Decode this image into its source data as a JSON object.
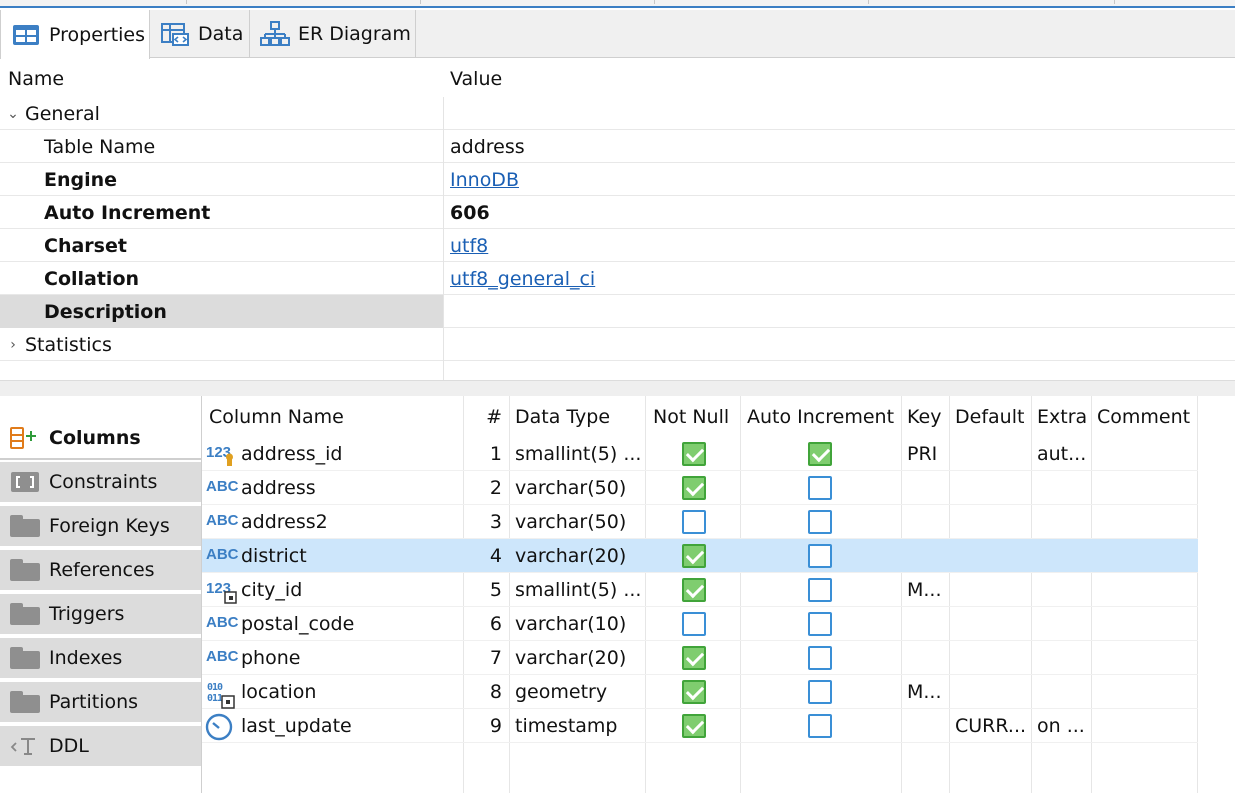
{
  "tabs": [
    {
      "label": "Properties",
      "icon": "properties-icon",
      "active": true
    },
    {
      "label": "Data",
      "icon": "data-grid-icon",
      "active": false
    },
    {
      "label": "ER Diagram",
      "icon": "er-diagram-icon",
      "active": false
    }
  ],
  "properties": {
    "header": {
      "name": "Name",
      "value": "Value"
    },
    "group_general": "General",
    "rows": [
      {
        "name": "Table Name",
        "value": "address"
      },
      {
        "name": "Engine",
        "value": "InnoDB"
      },
      {
        "name": "Auto Increment",
        "value": "606"
      },
      {
        "name": "Charset",
        "value": "utf8"
      },
      {
        "name": "Collation",
        "value": "utf8_general_ci"
      },
      {
        "name": "Description",
        "value": ""
      }
    ],
    "group_statistics": "Statistics"
  },
  "side_tabs": [
    {
      "label": "Columns",
      "icon": "columns-add-icon"
    },
    {
      "label": "Constraints",
      "icon": "constraints-icon"
    },
    {
      "label": "Foreign Keys",
      "icon": "folder-icon"
    },
    {
      "label": "References",
      "icon": "folder-icon"
    },
    {
      "label": "Triggers",
      "icon": "folder-icon"
    },
    {
      "label": "Indexes",
      "icon": "folder-icon"
    },
    {
      "label": "Partitions",
      "icon": "folder-icon"
    },
    {
      "label": "DDL",
      "icon": "ddl-icon"
    }
  ],
  "columns_table": {
    "headers": {
      "name": "Column Name",
      "num": "#",
      "type": "Data Type",
      "notnull": "Not Null",
      "autoinc": "Auto Increment",
      "key": "Key",
      "default": "Default",
      "extra": "Extra",
      "comment": "Comment"
    },
    "rows": [
      {
        "name": "address_id",
        "num": "1",
        "type": "smallint(5) ...",
        "notnull": true,
        "autoinc": true,
        "key": "PRI",
        "default": "",
        "extra": "aut...",
        "comment": "",
        "icon": "numeric-key-icon",
        "icon_text": "123"
      },
      {
        "name": "address",
        "num": "2",
        "type": "varchar(50)",
        "notnull": true,
        "autoinc": false,
        "key": "",
        "default": "",
        "extra": "",
        "comment": "",
        "icon": "text-column-icon",
        "icon_text": "ABC"
      },
      {
        "name": "address2",
        "num": "3",
        "type": "varchar(50)",
        "notnull": false,
        "autoinc": false,
        "key": "",
        "default": "",
        "extra": "",
        "comment": "",
        "icon": "text-column-icon",
        "icon_text": "ABC"
      },
      {
        "name": "district",
        "num": "4",
        "type": "varchar(20)",
        "notnull": true,
        "autoinc": false,
        "key": "",
        "default": "",
        "extra": "",
        "comment": "",
        "icon": "text-column-icon",
        "icon_text": "ABC"
      },
      {
        "name": "city_id",
        "num": "5",
        "type": "smallint(5) ...",
        "notnull": true,
        "autoinc": false,
        "key": "M...",
        "default": "",
        "extra": "",
        "comment": "",
        "icon": "numeric-index-icon",
        "icon_text": "123"
      },
      {
        "name": "postal_code",
        "num": "6",
        "type": "varchar(10)",
        "notnull": false,
        "autoinc": false,
        "key": "",
        "default": "",
        "extra": "",
        "comment": "",
        "icon": "text-column-icon",
        "icon_text": "ABC"
      },
      {
        "name": "phone",
        "num": "7",
        "type": "varchar(20)",
        "notnull": true,
        "autoinc": false,
        "key": "",
        "default": "",
        "extra": "",
        "comment": "",
        "icon": "text-column-icon",
        "icon_text": "ABC"
      },
      {
        "name": "location",
        "num": "8",
        "type": "geometry",
        "notnull": true,
        "autoinc": false,
        "key": "M...",
        "default": "",
        "extra": "",
        "comment": "",
        "icon": "binary-index-icon",
        "icon_text": "010"
      },
      {
        "name": "last_update",
        "num": "9",
        "type": "timestamp",
        "notnull": true,
        "autoinc": false,
        "key": "",
        "default": "CURR...",
        "extra": "on ...",
        "comment": "",
        "icon": "timestamp-icon",
        "icon_text": ""
      }
    ],
    "selected_index": 3
  },
  "colors": {
    "accent": "#3c7fc4",
    "link": "#1a5fb4",
    "selection": "#cde6fb",
    "check_on": "#7fcd6f"
  }
}
